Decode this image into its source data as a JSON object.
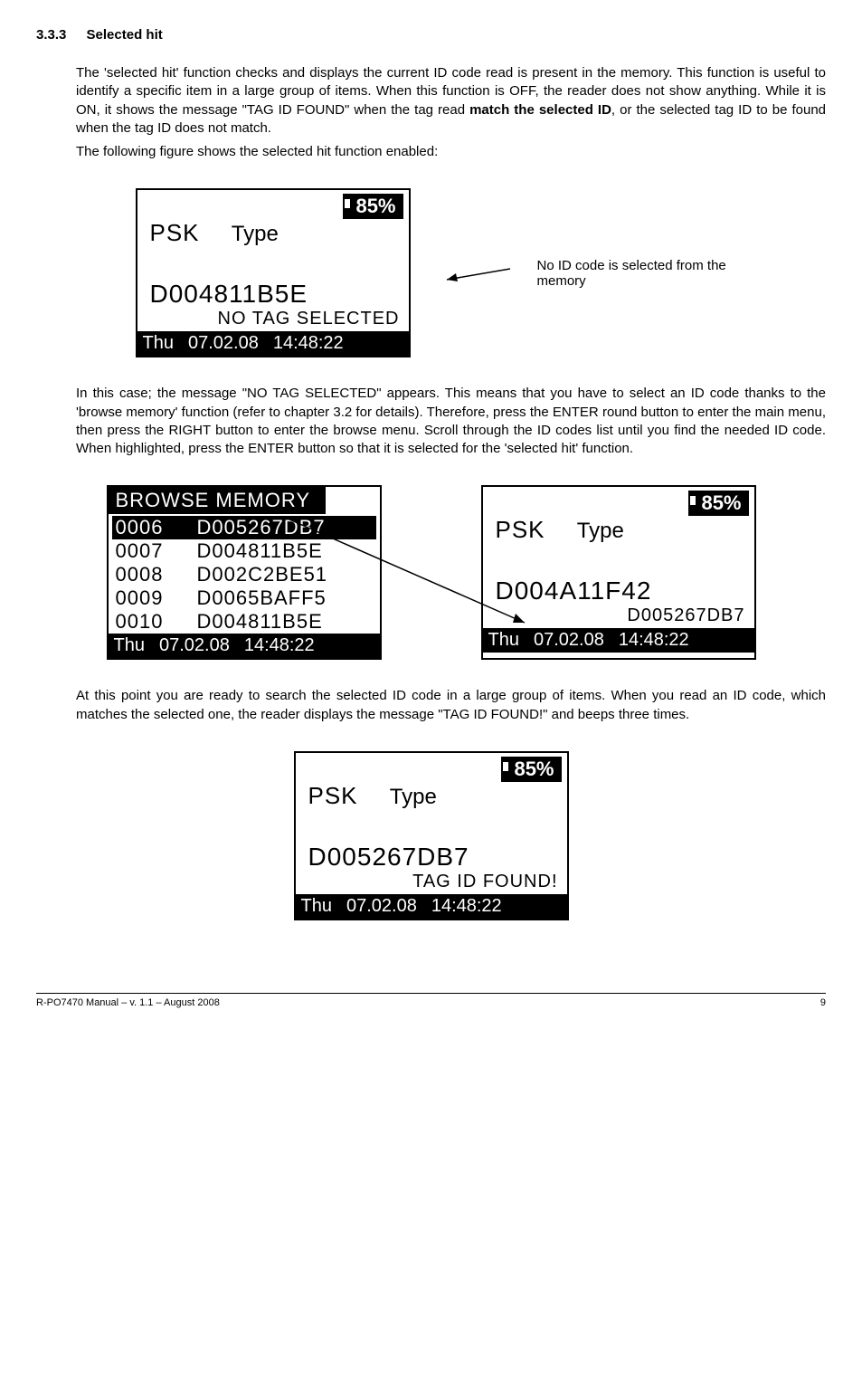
{
  "section": {
    "number": "3.3.3",
    "title": "Selected hit"
  },
  "para1a": "The 'selected hit' function checks and displays the current ID code read is present in the memory. This function is useful to identify a specific item in a large group of items. When this function is OFF, the reader does not show anything. While it is ON, it shows the message \"TAG ID FOUND\" when the tag read ",
  "para1bold": "match the selected ID",
  "para1b": ", or the selected tag ID to be found when the tag ID does not match.",
  "para1c": "The following figure shows the selected hit function enabled:",
  "annot1": "No ID code is selected from the memory",
  "lcdA": {
    "batt": "85%",
    "psk": "PSK",
    "type": "Type",
    "id": "D004811B5E",
    "msg": "NO  TAG SELECTED",
    "day": "Thu",
    "date": "07.02.08",
    "time": "14:48:22"
  },
  "para2": "In this case; the message \"NO TAG SELECTED\" appears. This means that you have to select an ID code thanks to the 'browse memory' function (refer to chapter 3.2 for details). Therefore, press the ENTER round button to enter the main menu, then press the RIGHT button to enter the browse menu. Scroll through the ID codes list until you find the needed ID code. When highlighted, press the ENTER button so that it is selected for the 'selected hit' function.",
  "browse": {
    "title": "BROWSE MEMORY",
    "rows": [
      {
        "idx": "0006",
        "val": "D005267DB7",
        "selected": true
      },
      {
        "idx": "0007",
        "val": "D004811B5E",
        "selected": false
      },
      {
        "idx": "0008",
        "val": "D002C2BE51",
        "selected": false
      },
      {
        "idx": "0009",
        "val": "D0065BAFF5",
        "selected": false
      },
      {
        "idx": "0010",
        "val": "D004811B5E",
        "selected": false
      }
    ],
    "day": "Thu",
    "date": "07.02.08",
    "time": "14:48:22"
  },
  "lcdB": {
    "batt": "85%",
    "psk": "PSK",
    "type": "Type",
    "id": "D004A11F42",
    "msg": "D005267DB7",
    "day": "Thu",
    "date": "07.02.08",
    "time": "14:48:22"
  },
  "para3": "At this point you are ready to search the selected ID code in a large group of items. When you read an ID code, which matches the selected one, the reader displays the message \"TAG ID FOUND!\" and beeps three times.",
  "lcdC": {
    "batt": "85%",
    "psk": "PSK",
    "type": "Type",
    "id": "D005267DB7",
    "msg": "TAG ID FOUND!",
    "day": "Thu",
    "date": "07.02.08",
    "time": "14:48:22"
  },
  "footer": {
    "left": "R-PO7470 Manual – v. 1.1 – August 2008",
    "right": "9"
  }
}
